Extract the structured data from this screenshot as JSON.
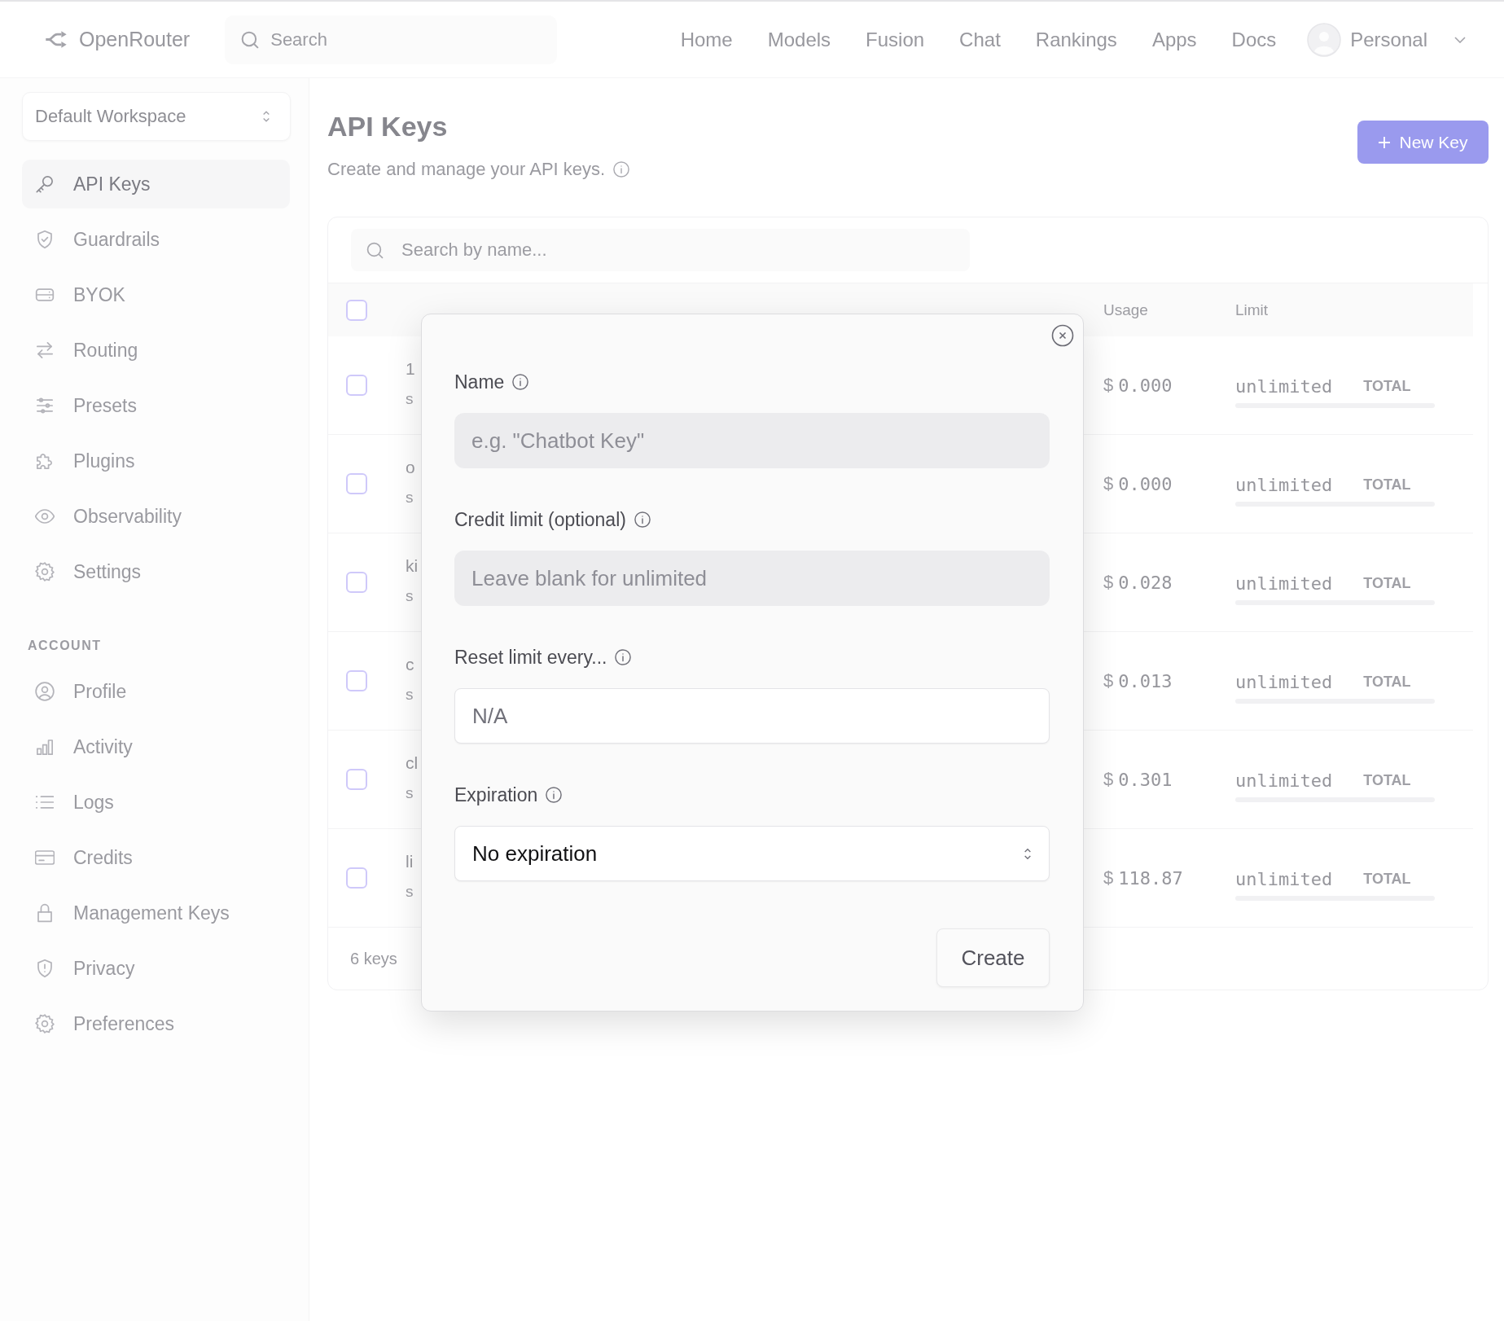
{
  "header": {
    "logo": "OpenRouter",
    "search": {
      "placeholder": "Search"
    },
    "nav": [
      {
        "label": "Home"
      },
      {
        "label": "Models"
      },
      {
        "label": "Fusion"
      },
      {
        "label": "Chat"
      },
      {
        "label": "Rankings"
      },
      {
        "label": "Apps"
      },
      {
        "label": "Docs"
      }
    ],
    "account": {
      "label": "Personal"
    }
  },
  "sidebar": {
    "workspace": "Default Workspace",
    "groups": [
      {
        "items": [
          {
            "label": "API Keys",
            "selected": true
          },
          {
            "label": "Guardrails",
            "selected": false
          },
          {
            "label": "BYOK",
            "selected": false
          },
          {
            "label": "Routing",
            "selected": false
          },
          {
            "label": "Presets",
            "selected": false
          },
          {
            "label": "Plugins",
            "selected": false
          },
          {
            "label": "Observability",
            "selected": false
          },
          {
            "label": "Settings",
            "selected": false
          }
        ]
      },
      {
        "heading": "ACCOUNT",
        "items": [
          {
            "label": "Profile",
            "selected": false
          },
          {
            "label": "Activity",
            "selected": false
          },
          {
            "label": "Logs",
            "selected": false
          },
          {
            "label": "Credits",
            "selected": false
          },
          {
            "label": "Management Keys",
            "selected": false
          },
          {
            "label": "Privacy",
            "selected": false
          },
          {
            "label": "Preferences",
            "selected": false
          }
        ]
      }
    ]
  },
  "main": {
    "title": "API Keys",
    "subtitle": "Create and manage your API keys.",
    "new_key_button": "New Key",
    "table": {
      "search": {
        "placeholder": "Search by name..."
      },
      "select_all": {
        "checked": false
      },
      "columns": [
        "Usage",
        "Limit"
      ],
      "rows": [
        {
          "checked": false,
          "name": "1",
          "key": "s",
          "currency": "$",
          "usage": "0.000",
          "limit": "unlimited",
          "period": "TOTAL",
          "level": 0
        },
        {
          "checked": false,
          "name": "o",
          "key": "s",
          "currency": "$",
          "usage": "0.000",
          "limit": "unlimited",
          "period": "TOTAL",
          "level": 0
        },
        {
          "checked": false,
          "name": "ki",
          "key": "s",
          "currency": "$",
          "usage": "0.028",
          "limit": "unlimited",
          "period": "TOTAL",
          "level": 0
        },
        {
          "checked": false,
          "name": "c",
          "key": "s",
          "currency": "$",
          "usage": "0.013",
          "limit": "unlimited",
          "period": "TOTAL",
          "level": 0
        },
        {
          "checked": false,
          "name": "cl",
          "key": "s",
          "currency": "$",
          "usage": "0.301",
          "limit": "unlimited",
          "period": "TOTAL",
          "level": 0
        },
        {
          "checked": false,
          "name": "li",
          "key": "s",
          "currency": "$",
          "usage": "118.87",
          "limit": "unlimited",
          "period": "TOTAL",
          "level": 0
        }
      ],
      "footer": "6 keys"
    }
  },
  "dialog": {
    "fields": [
      {
        "kind": "text",
        "label": "Name",
        "placeholder": "e.g. \"Chatbot Key\""
      },
      {
        "kind": "text",
        "label": "Credit limit (optional)",
        "placeholder": "Leave blank for unlimited"
      },
      {
        "kind": "static",
        "label": "Reset limit every...",
        "value": "N/A"
      },
      {
        "kind": "select",
        "label": "Expiration",
        "value": "No expiration"
      }
    ],
    "submit": "Create"
  }
}
